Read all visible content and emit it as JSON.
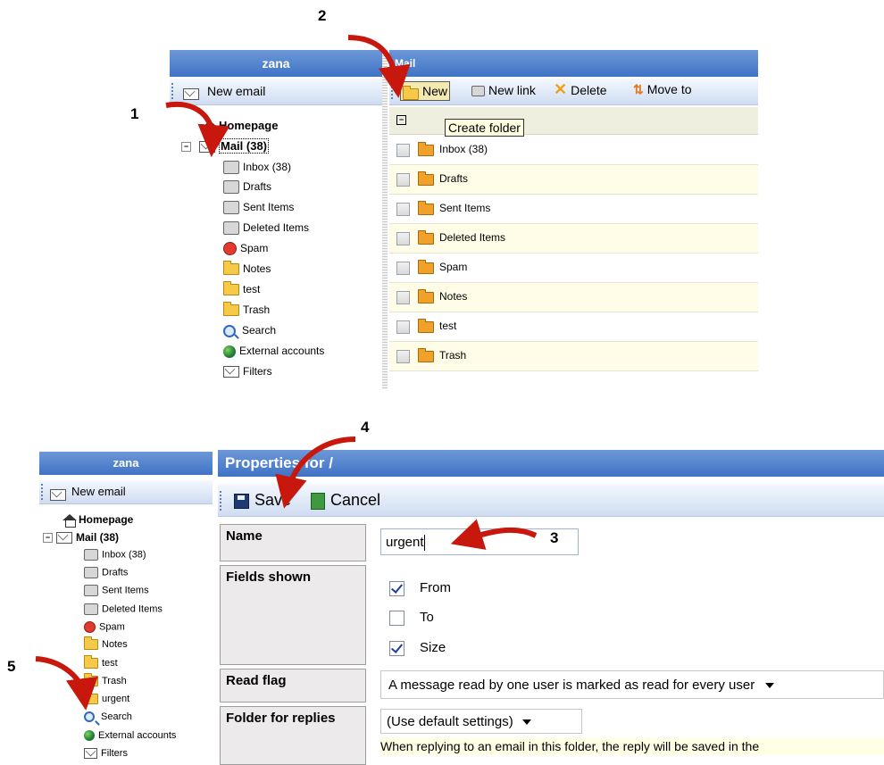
{
  "top": {
    "sidebar_user": "zana",
    "new_email": "New email",
    "homepage": "Homepage",
    "mail_root": "Mail (38)",
    "tree_items": [
      "Inbox (38)",
      "Drafts",
      "Sent Items",
      "Deleted Items",
      "Spam",
      "Notes",
      "test",
      "Trash",
      "Search",
      "External accounts",
      "Filters"
    ],
    "main_title": "Mail",
    "toolbar": {
      "new": "New",
      "new_link": "New link",
      "delete": "Delete",
      "move_to": "Move to"
    },
    "tooltip": "Create folder",
    "folders": [
      "Inbox (38)",
      "Drafts",
      "Sent Items",
      "Deleted Items",
      "Spam",
      "Notes",
      "test",
      "Trash"
    ]
  },
  "bottom": {
    "sidebar_user": "zana",
    "new_email": "New email",
    "homepage": "Homepage",
    "mail_root": "Mail (38)",
    "tree_items": [
      "Inbox (38)",
      "Drafts",
      "Sent Items",
      "Deleted Items",
      "Spam",
      "Notes",
      "test",
      "Trash",
      "urgent",
      "Search",
      "External accounts",
      "Filters"
    ],
    "header": "Properties for /",
    "save": "Save",
    "cancel": "Cancel",
    "name_label": "Name",
    "name_value": "urgent",
    "fields_label": "Fields shown",
    "fields": [
      {
        "label": "From",
        "checked": true
      },
      {
        "label": "To",
        "checked": false
      },
      {
        "label": "Size",
        "checked": true
      }
    ],
    "read_flag_label": "Read flag",
    "read_flag_value": "A message read by one user is marked as read for every user",
    "replies_label": "Folder for replies",
    "replies_value": "(Use default settings)",
    "replies_hint": "When replying to an email in this folder, the reply will be saved in the"
  },
  "annotations": [
    "1",
    "2",
    "3",
    "4",
    "5"
  ],
  "colors": {
    "header_blue": "#4a7ccb",
    "toolbar_bg": "#dfe8f7",
    "tooltip_bg": "#ffffe1",
    "arrow_red": "#c8180e",
    "row_alt": "#fffde8"
  }
}
